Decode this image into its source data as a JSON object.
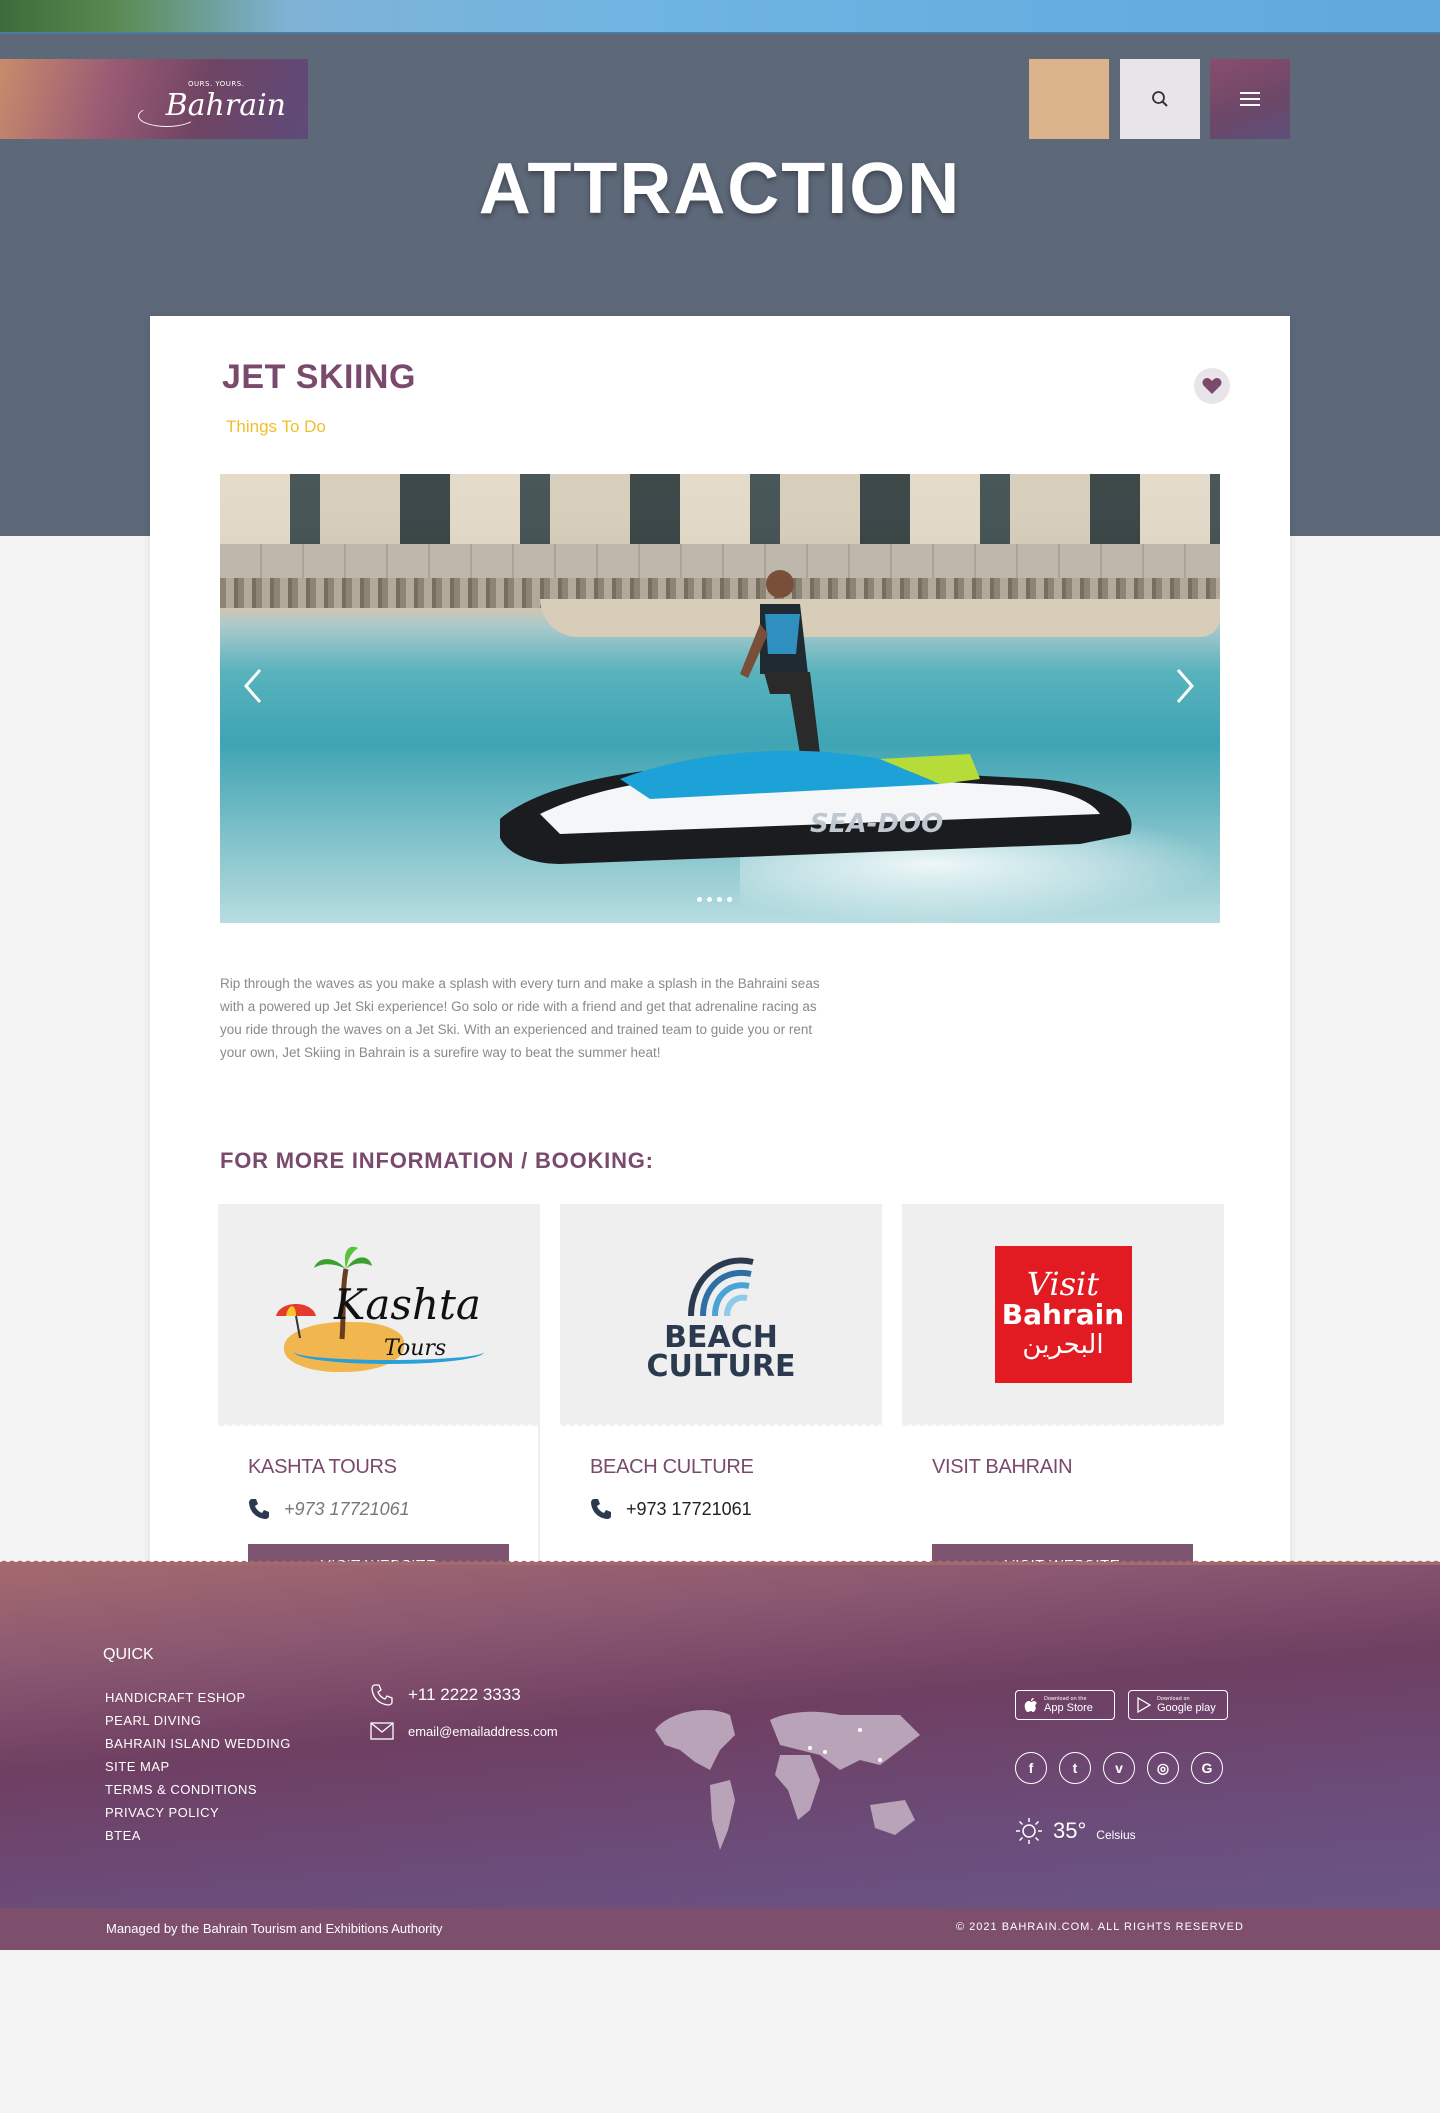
{
  "header": {
    "logo_tagline": "OURS. YOURS.",
    "logo_text": "Bahrain",
    "page_title": "ATTRACTION"
  },
  "attraction": {
    "title": "JET SKIING",
    "category": "Things To Do",
    "description": "Rip through the waves as you make a splash with every turn and make a splash in the Bahraini seas with a powered up Jet Ski experience! Go solo or ride with a friend and get that adrenaline racing as you ride through the waves on a Jet Ski. With an experienced and trained team to guide you or rent your own, Jet Skiing in Bahrain is a surefire way to beat the summer heat!",
    "slider_watermark": "SEA-DOO",
    "slider_total": 4
  },
  "booking": {
    "heading": "FOR MORE INFORMATION / BOOKING:",
    "providers": [
      {
        "name": "KASHTA TOURS",
        "phone": "+973 17721061",
        "button": "VISIT WEBSITE",
        "logo_word": "Kashta",
        "logo_sub": "Tours"
      },
      {
        "name": "BEACH CULTURE",
        "phone": "+973 17721061",
        "logo_line1": "BEACH",
        "logo_line2": "CULTURE"
      },
      {
        "name": "VISIT BAHRAIN",
        "button": "VISIT WEBSITE",
        "logo_line1": "Visit",
        "logo_line2": "Bahrain",
        "logo_line3": "البحرين"
      }
    ]
  },
  "footer": {
    "quick_links_title": "QUICK",
    "links": [
      "HANDICRAFT ESHOP",
      "PEARL DIVING",
      "BAHRAIN ISLAND WEDDING",
      "SITE MAP",
      "TERMS & CONDITIONS",
      "PRIVACY POLICY",
      "BTEA"
    ],
    "phone": "+11 2222 3333",
    "email": "email@emailaddress.com",
    "app_store_small": "Download on the",
    "app_store_big": "App Store",
    "google_small": "Download on",
    "google_big": "Google play",
    "socials": [
      "facebook-icon",
      "twitter-icon",
      "vimeo-icon",
      "instagram-icon",
      "google-icon"
    ],
    "temperature": "35°",
    "temperature_unit": "Celsius",
    "managed_by": "Managed by the Bahrain Tourism and Exhibitions Authority",
    "copyright": "© 2021 BAHRAIN.COM. ALL RIGHTS RESERVED"
  },
  "colors": {
    "brand_purple": "#7a4a6c",
    "accent_yellow": "#f0c02a",
    "hero_bg": "#5d6878",
    "button_bg": "#7e5570"
  }
}
